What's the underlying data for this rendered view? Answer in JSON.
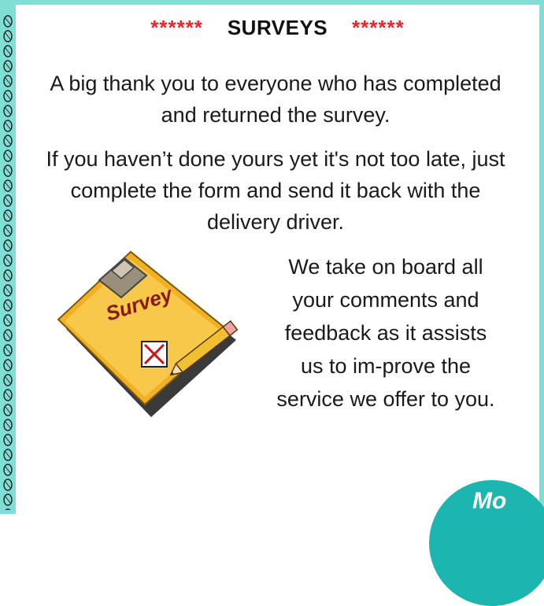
{
  "heading": {
    "stars_left": "******",
    "title": "SURVEYS",
    "stars_right": "******"
  },
  "paragraphs": {
    "thank_you": "A big thank you to everyone who has completed  and returned the survey.",
    "reminder": "If you haven’t done yours yet it's not too late, just complete the form and send it back with the delivery driver.",
    "feedback": "We take on board all your comments and feedback as it assists us to im-prove the service we offer to you."
  },
  "clipboard": {
    "label": "Survey"
  },
  "badge": {
    "text": "Mo"
  },
  "colors": {
    "border": "#7fded6",
    "stars": "#e8262b",
    "badge": "#1cb5b0",
    "clipboard": "#f2b122"
  }
}
